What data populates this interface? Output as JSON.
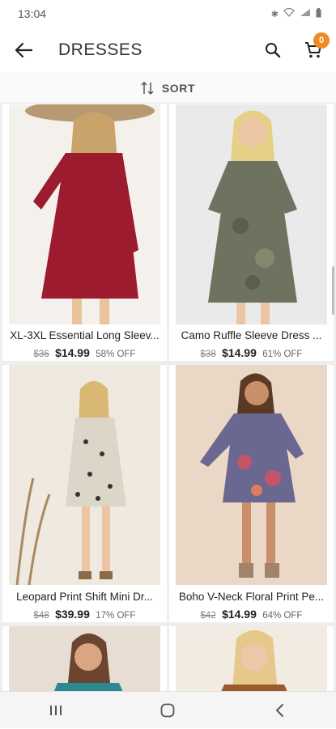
{
  "status_bar": {
    "time": "13:04"
  },
  "header": {
    "title": "DRESSES",
    "cart_count": "0"
  },
  "sort": {
    "label": "SORT"
  },
  "products": [
    {
      "name": "XL-3XL Essential Long Sleev...",
      "old_price": "$36",
      "price": "$14.99",
      "discount": "58% OFF",
      "color": "#9c1b2e"
    },
    {
      "name": "Camo Ruffle Sleeve Dress ...",
      "old_price": "$38",
      "price": "$14.99",
      "discount": "61% OFF",
      "color": "#6e7360"
    },
    {
      "name": "Leopard Print Shift Mini Dr...",
      "old_price": "$48",
      "price": "$39.99",
      "discount": "17% OFF",
      "color": "#d8d2c8"
    },
    {
      "name": "Boho V-Neck Floral Print Pe...",
      "old_price": "$42",
      "price": "$14.99",
      "discount": "64% OFF",
      "color": "#6a6790"
    },
    {
      "name": "",
      "old_price": "",
      "price": "",
      "discount": "",
      "color": "#2a8a92"
    },
    {
      "name": "",
      "old_price": "",
      "price": "",
      "discount": "",
      "color": "#9a5a2e"
    }
  ]
}
